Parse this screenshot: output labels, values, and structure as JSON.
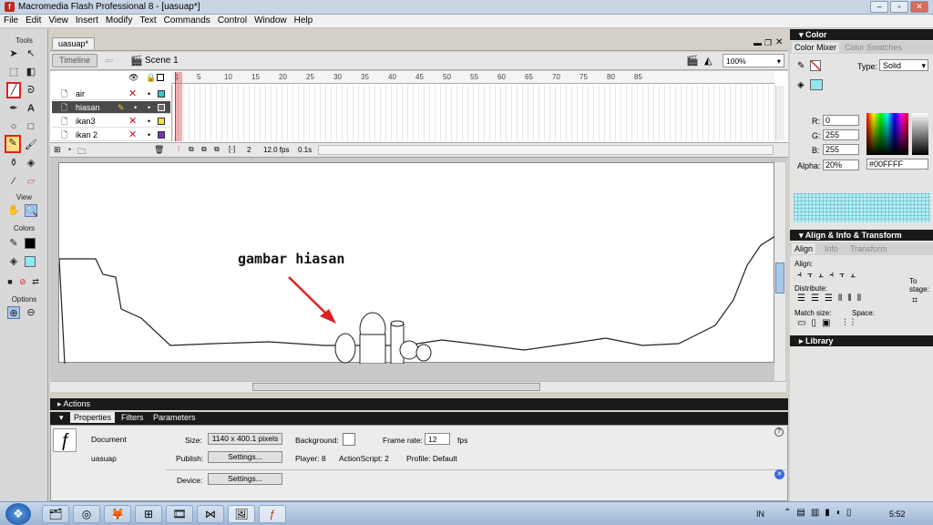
{
  "window": {
    "title": "Macromedia Flash Professional 8 - [uasuap*]"
  },
  "menu": [
    "File",
    "Edit",
    "View",
    "Insert",
    "Modify",
    "Text",
    "Commands",
    "Control",
    "Window",
    "Help"
  ],
  "tools": {
    "header": "Tools",
    "view": "View",
    "colors": "Colors",
    "options": "Options"
  },
  "document": {
    "tab": "uasuap*",
    "timeline_button": "Timeline",
    "scene": "Scene 1",
    "zoom": "100%"
  },
  "timeline": {
    "layers": [
      {
        "name": "air",
        "color": "#30c8d0"
      },
      {
        "name": "hiasan",
        "color": "#6a6a6a"
      },
      {
        "name": "ikan3",
        "color": "#f0e030"
      },
      {
        "name": "ikan 2",
        "color": "#8030c0"
      }
    ],
    "ruler": [
      "1",
      "5",
      "10",
      "15",
      "20",
      "25",
      "30",
      "35",
      "40",
      "45",
      "50",
      "55",
      "60",
      "65",
      "70",
      "75",
      "80",
      "85"
    ],
    "frame": "2",
    "fps": "12.0 fps",
    "time": "0.1s"
  },
  "stage": {
    "annotation": "gambar hiasan"
  },
  "panels": {
    "actions": "Actions",
    "properties_tabs": [
      "Properties",
      "Filters",
      "Parameters"
    ]
  },
  "properties": {
    "doc_label": "Document",
    "doc_name": "uasuap",
    "size_label": "Size:",
    "size_value": "1140 x 400.1 pixels",
    "background_label": "Background:",
    "framerate_label": "Frame rate:",
    "framerate_value": "12",
    "fps": "fps",
    "publish_label": "Publish:",
    "settings": "Settings...",
    "player": "Player: 8",
    "actionscript": "ActionScript: 2",
    "profile": "Profile: Default",
    "device_label": "Device:"
  },
  "color_panel": {
    "title": "Color",
    "tabs": [
      "Color Mixer",
      "Color Swatches"
    ],
    "type_label": "Type:",
    "type_value": "Solid",
    "r_label": "R:",
    "r": "0",
    "g_label": "G:",
    "g": "255",
    "b_label": "B:",
    "b": "255",
    "alpha_label": "Alpha:",
    "alpha": "20%",
    "hex": "#00FFFF"
  },
  "align_panel": {
    "title": "Align & Info & Transform",
    "tabs": [
      "Align",
      "Info",
      "Transform"
    ],
    "align": "Align:",
    "distribute": "Distribute:",
    "match_size": "Match size:",
    "space": "Space:",
    "to_stage_1": "To",
    "to_stage_2": "stage:"
  },
  "library": {
    "title": "Library"
  },
  "taskbar": {
    "lang": "IN",
    "clock": "5:52"
  }
}
